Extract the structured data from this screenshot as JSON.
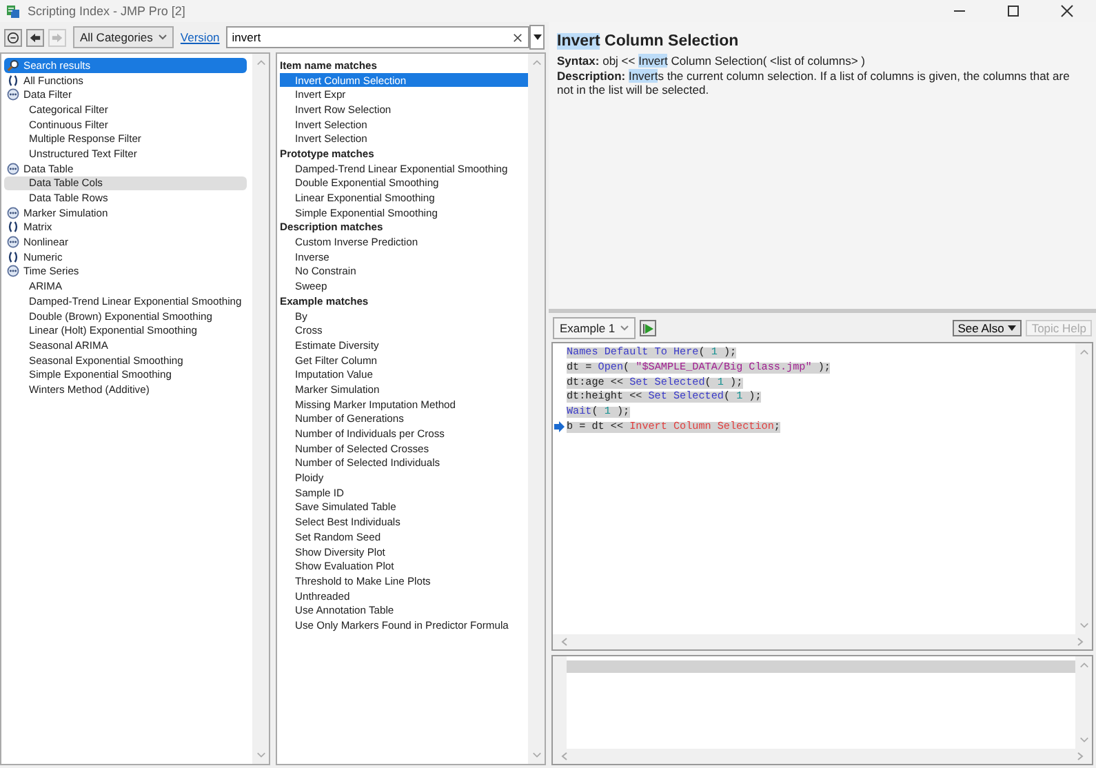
{
  "window": {
    "title": "Scripting Index - JMP Pro [2]"
  },
  "toolbar": {
    "category": "All Categories",
    "version_link": "Version",
    "search": {
      "value": "invert"
    }
  },
  "tree": [
    {
      "kind": "search",
      "label": "Search results",
      "selected": true,
      "hovered": false
    },
    {
      "kind": "function",
      "label": "All Functions",
      "selected": false,
      "hovered": false
    },
    {
      "kind": "object",
      "label": "Data Filter",
      "selected": false,
      "hovered": false,
      "children": [
        {
          "label": "Categorical Filter",
          "selected": false,
          "hovered": false
        },
        {
          "label": "Continuous Filter",
          "selected": false,
          "hovered": false
        },
        {
          "label": "Multiple Response Filter",
          "selected": false,
          "hovered": false
        },
        {
          "label": "Unstructured Text Filter",
          "selected": false,
          "hovered": false
        }
      ]
    },
    {
      "kind": "object",
      "label": "Data Table",
      "selected": false,
      "hovered": false,
      "children": [
        {
          "label": "Data Table Cols",
          "selected": false,
          "hovered": true
        },
        {
          "label": "Data Table Rows",
          "selected": false,
          "hovered": false
        }
      ]
    },
    {
      "kind": "object",
      "label": "Marker Simulation",
      "selected": false,
      "hovered": false
    },
    {
      "kind": "function",
      "label": "Matrix",
      "selected": false,
      "hovered": false
    },
    {
      "kind": "object",
      "label": "Nonlinear",
      "selected": false,
      "hovered": false
    },
    {
      "kind": "function",
      "label": "Numeric",
      "selected": false,
      "hovered": false
    },
    {
      "kind": "object",
      "label": "Time Series",
      "selected": false,
      "hovered": false,
      "children": [
        {
          "label": "ARIMA",
          "selected": false,
          "hovered": false
        },
        {
          "label": "Damped-Trend Linear Exponential Smoothing",
          "selected": false,
          "hovered": false
        },
        {
          "label": "Double (Brown) Exponential Smoothing",
          "selected": false,
          "hovered": false
        },
        {
          "label": "Linear (Holt) Exponential Smoothing",
          "selected": false,
          "hovered": false
        },
        {
          "label": "Seasonal ARIMA",
          "selected": false,
          "hovered": false
        },
        {
          "label": "Seasonal Exponential Smoothing",
          "selected": false,
          "hovered": false
        },
        {
          "label": "Simple Exponential Smoothing",
          "selected": false,
          "hovered": false
        },
        {
          "label": "Winters Method (Additive)",
          "selected": false,
          "hovered": false
        }
      ]
    }
  ],
  "matches": [
    {
      "heading": "Item name matches",
      "items": [
        {
          "label": "Invert Column Selection",
          "selected": true
        },
        {
          "label": "Invert Expr",
          "selected": false
        },
        {
          "label": "Invert Row Selection",
          "selected": false
        },
        {
          "label": "Invert Selection",
          "selected": false
        },
        {
          "label": "Invert Selection",
          "selected": false
        }
      ]
    },
    {
      "heading": "Prototype matches",
      "items": [
        {
          "label": "Damped-Trend Linear Exponential Smoothing",
          "selected": false
        },
        {
          "label": "Double Exponential Smoothing",
          "selected": false
        },
        {
          "label": "Linear Exponential Smoothing",
          "selected": false
        },
        {
          "label": "Simple Exponential Smoothing",
          "selected": false
        }
      ]
    },
    {
      "heading": "Description matches",
      "items": [
        {
          "label": "Custom Inverse Prediction",
          "selected": false
        },
        {
          "label": "Inverse",
          "selected": false
        },
        {
          "label": "No Constrain",
          "selected": false
        },
        {
          "label": "Sweep",
          "selected": false
        }
      ]
    },
    {
      "heading": "Example matches",
      "items": [
        {
          "label": "By",
          "selected": false
        },
        {
          "label": "Cross",
          "selected": false
        },
        {
          "label": "Estimate Diversity",
          "selected": false
        },
        {
          "label": "Get Filter Column",
          "selected": false
        },
        {
          "label": "Imputation Value",
          "selected": false
        },
        {
          "label": "Marker Simulation",
          "selected": false
        },
        {
          "label": "Missing Marker Imputation Method",
          "selected": false
        },
        {
          "label": "Number of Generations",
          "selected": false
        },
        {
          "label": "Number of Individuals per Cross",
          "selected": false
        },
        {
          "label": "Number of Selected Crosses",
          "selected": false
        },
        {
          "label": "Number of Selected Individuals",
          "selected": false
        },
        {
          "label": "Ploidy",
          "selected": false
        },
        {
          "label": "Sample ID",
          "selected": false
        },
        {
          "label": "Save Simulated Table",
          "selected": false
        },
        {
          "label": "Select Best Individuals",
          "selected": false
        },
        {
          "label": "Set Random Seed",
          "selected": false
        },
        {
          "label": "Show Diversity Plot",
          "selected": false
        },
        {
          "label": "Show Evaluation Plot",
          "selected": false
        },
        {
          "label": "Threshold to Make Line Plots",
          "selected": false
        },
        {
          "label": "Unthreaded",
          "selected": false
        },
        {
          "label": "Use Annotation Table",
          "selected": false
        },
        {
          "label": "Use Only Markers Found in Predictor Formula",
          "selected": false
        }
      ]
    }
  ],
  "doc": {
    "title": [
      {
        "text": "Invert",
        "highlighted": true
      },
      {
        "text": " Column Selection",
        "highlighted": false
      }
    ],
    "syntax_label": "Syntax:",
    "syntax": [
      {
        "text": "obj << ",
        "highlighted": false
      },
      {
        "text": "Invert",
        "highlighted": true
      },
      {
        "text": " Column Selection( <list of columns> )",
        "highlighted": false
      }
    ],
    "description_label": "Description:",
    "description": [
      {
        "text": "Invert",
        "highlighted": true
      },
      {
        "text": "s the current column selection. If a list of columns is given, the columns that are not in the list will be selected.",
        "highlighted": false
      }
    ]
  },
  "example": {
    "selector": "Example 1",
    "see_also": "See Also",
    "topic_help": {
      "label": "Topic Help",
      "disabled": true
    },
    "lines": [
      {
        "current": false,
        "selected": true,
        "tokens": [
          {
            "kind": "builtin",
            "text": "Names Default To Here"
          },
          {
            "kind": "plain",
            "text": "( "
          },
          {
            "kind": "number",
            "text": "1"
          },
          {
            "kind": "plain",
            "text": " );"
          }
        ]
      },
      {
        "current": false,
        "selected": true,
        "tokens": [
          {
            "kind": "plain",
            "text": "dt = "
          },
          {
            "kind": "builtin",
            "text": "Open"
          },
          {
            "kind": "plain",
            "text": "( "
          },
          {
            "kind": "string",
            "text": "\"$SAMPLE_DATA/Big Class.jmp\""
          },
          {
            "kind": "plain",
            "text": " );"
          }
        ]
      },
      {
        "current": false,
        "selected": true,
        "tokens": [
          {
            "kind": "plain",
            "text": "dt:age << "
          },
          {
            "kind": "builtin",
            "text": "Set Selected"
          },
          {
            "kind": "plain",
            "text": "( "
          },
          {
            "kind": "number",
            "text": "1"
          },
          {
            "kind": "plain",
            "text": " );"
          }
        ]
      },
      {
        "current": false,
        "selected": true,
        "tokens": [
          {
            "kind": "plain",
            "text": "dt:height << "
          },
          {
            "kind": "builtin",
            "text": "Set Selected"
          },
          {
            "kind": "plain",
            "text": "( "
          },
          {
            "kind": "number",
            "text": "1"
          },
          {
            "kind": "plain",
            "text": " );"
          }
        ]
      },
      {
        "current": false,
        "selected": true,
        "tokens": [
          {
            "kind": "builtin",
            "text": "Wait"
          },
          {
            "kind": "plain",
            "text": "( "
          },
          {
            "kind": "number",
            "text": "1"
          },
          {
            "kind": "plain",
            "text": " );"
          }
        ]
      },
      {
        "current": true,
        "selected": true,
        "tokens": [
          {
            "kind": "plain",
            "text": "b = dt << "
          },
          {
            "kind": "message",
            "text": "Invert Column Selection"
          },
          {
            "kind": "plain",
            "text": ";"
          }
        ]
      }
    ]
  }
}
